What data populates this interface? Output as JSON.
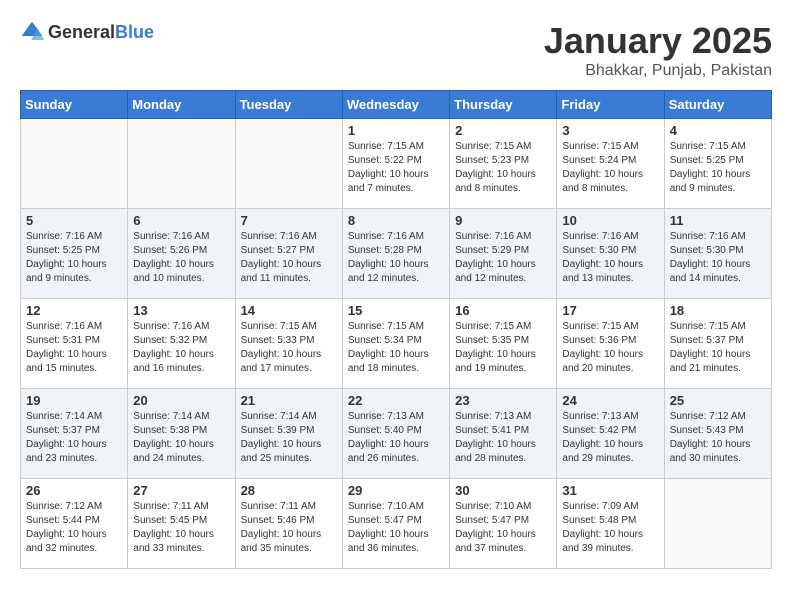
{
  "logo": {
    "general": "General",
    "blue": "Blue"
  },
  "title": "January 2025",
  "subtitle": "Bhakkar, Punjab, Pakistan",
  "days_of_week": [
    "Sunday",
    "Monday",
    "Tuesday",
    "Wednesday",
    "Thursday",
    "Friday",
    "Saturday"
  ],
  "weeks": [
    [
      {
        "day": "",
        "info": ""
      },
      {
        "day": "",
        "info": ""
      },
      {
        "day": "",
        "info": ""
      },
      {
        "day": "1",
        "info": "Sunrise: 7:15 AM\nSunset: 5:22 PM\nDaylight: 10 hours and 7 minutes."
      },
      {
        "day": "2",
        "info": "Sunrise: 7:15 AM\nSunset: 5:23 PM\nDaylight: 10 hours and 8 minutes."
      },
      {
        "day": "3",
        "info": "Sunrise: 7:15 AM\nSunset: 5:24 PM\nDaylight: 10 hours and 8 minutes."
      },
      {
        "day": "4",
        "info": "Sunrise: 7:15 AM\nSunset: 5:25 PM\nDaylight: 10 hours and 9 minutes."
      }
    ],
    [
      {
        "day": "5",
        "info": "Sunrise: 7:16 AM\nSunset: 5:25 PM\nDaylight: 10 hours and 9 minutes."
      },
      {
        "day": "6",
        "info": "Sunrise: 7:16 AM\nSunset: 5:26 PM\nDaylight: 10 hours and 10 minutes."
      },
      {
        "day": "7",
        "info": "Sunrise: 7:16 AM\nSunset: 5:27 PM\nDaylight: 10 hours and 11 minutes."
      },
      {
        "day": "8",
        "info": "Sunrise: 7:16 AM\nSunset: 5:28 PM\nDaylight: 10 hours and 12 minutes."
      },
      {
        "day": "9",
        "info": "Sunrise: 7:16 AM\nSunset: 5:29 PM\nDaylight: 10 hours and 12 minutes."
      },
      {
        "day": "10",
        "info": "Sunrise: 7:16 AM\nSunset: 5:30 PM\nDaylight: 10 hours and 13 minutes."
      },
      {
        "day": "11",
        "info": "Sunrise: 7:16 AM\nSunset: 5:30 PM\nDaylight: 10 hours and 14 minutes."
      }
    ],
    [
      {
        "day": "12",
        "info": "Sunrise: 7:16 AM\nSunset: 5:31 PM\nDaylight: 10 hours and 15 minutes."
      },
      {
        "day": "13",
        "info": "Sunrise: 7:16 AM\nSunset: 5:32 PM\nDaylight: 10 hours and 16 minutes."
      },
      {
        "day": "14",
        "info": "Sunrise: 7:15 AM\nSunset: 5:33 PM\nDaylight: 10 hours and 17 minutes."
      },
      {
        "day": "15",
        "info": "Sunrise: 7:15 AM\nSunset: 5:34 PM\nDaylight: 10 hours and 18 minutes."
      },
      {
        "day": "16",
        "info": "Sunrise: 7:15 AM\nSunset: 5:35 PM\nDaylight: 10 hours and 19 minutes."
      },
      {
        "day": "17",
        "info": "Sunrise: 7:15 AM\nSunset: 5:36 PM\nDaylight: 10 hours and 20 minutes."
      },
      {
        "day": "18",
        "info": "Sunrise: 7:15 AM\nSunset: 5:37 PM\nDaylight: 10 hours and 21 minutes."
      }
    ],
    [
      {
        "day": "19",
        "info": "Sunrise: 7:14 AM\nSunset: 5:37 PM\nDaylight: 10 hours and 23 minutes."
      },
      {
        "day": "20",
        "info": "Sunrise: 7:14 AM\nSunset: 5:38 PM\nDaylight: 10 hours and 24 minutes."
      },
      {
        "day": "21",
        "info": "Sunrise: 7:14 AM\nSunset: 5:39 PM\nDaylight: 10 hours and 25 minutes."
      },
      {
        "day": "22",
        "info": "Sunrise: 7:13 AM\nSunset: 5:40 PM\nDaylight: 10 hours and 26 minutes."
      },
      {
        "day": "23",
        "info": "Sunrise: 7:13 AM\nSunset: 5:41 PM\nDaylight: 10 hours and 28 minutes."
      },
      {
        "day": "24",
        "info": "Sunrise: 7:13 AM\nSunset: 5:42 PM\nDaylight: 10 hours and 29 minutes."
      },
      {
        "day": "25",
        "info": "Sunrise: 7:12 AM\nSunset: 5:43 PM\nDaylight: 10 hours and 30 minutes."
      }
    ],
    [
      {
        "day": "26",
        "info": "Sunrise: 7:12 AM\nSunset: 5:44 PM\nDaylight: 10 hours and 32 minutes."
      },
      {
        "day": "27",
        "info": "Sunrise: 7:11 AM\nSunset: 5:45 PM\nDaylight: 10 hours and 33 minutes."
      },
      {
        "day": "28",
        "info": "Sunrise: 7:11 AM\nSunset: 5:46 PM\nDaylight: 10 hours and 35 minutes."
      },
      {
        "day": "29",
        "info": "Sunrise: 7:10 AM\nSunset: 5:47 PM\nDaylight: 10 hours and 36 minutes."
      },
      {
        "day": "30",
        "info": "Sunrise: 7:10 AM\nSunset: 5:47 PM\nDaylight: 10 hours and 37 minutes."
      },
      {
        "day": "31",
        "info": "Sunrise: 7:09 AM\nSunset: 5:48 PM\nDaylight: 10 hours and 39 minutes."
      },
      {
        "day": "",
        "info": ""
      }
    ]
  ]
}
